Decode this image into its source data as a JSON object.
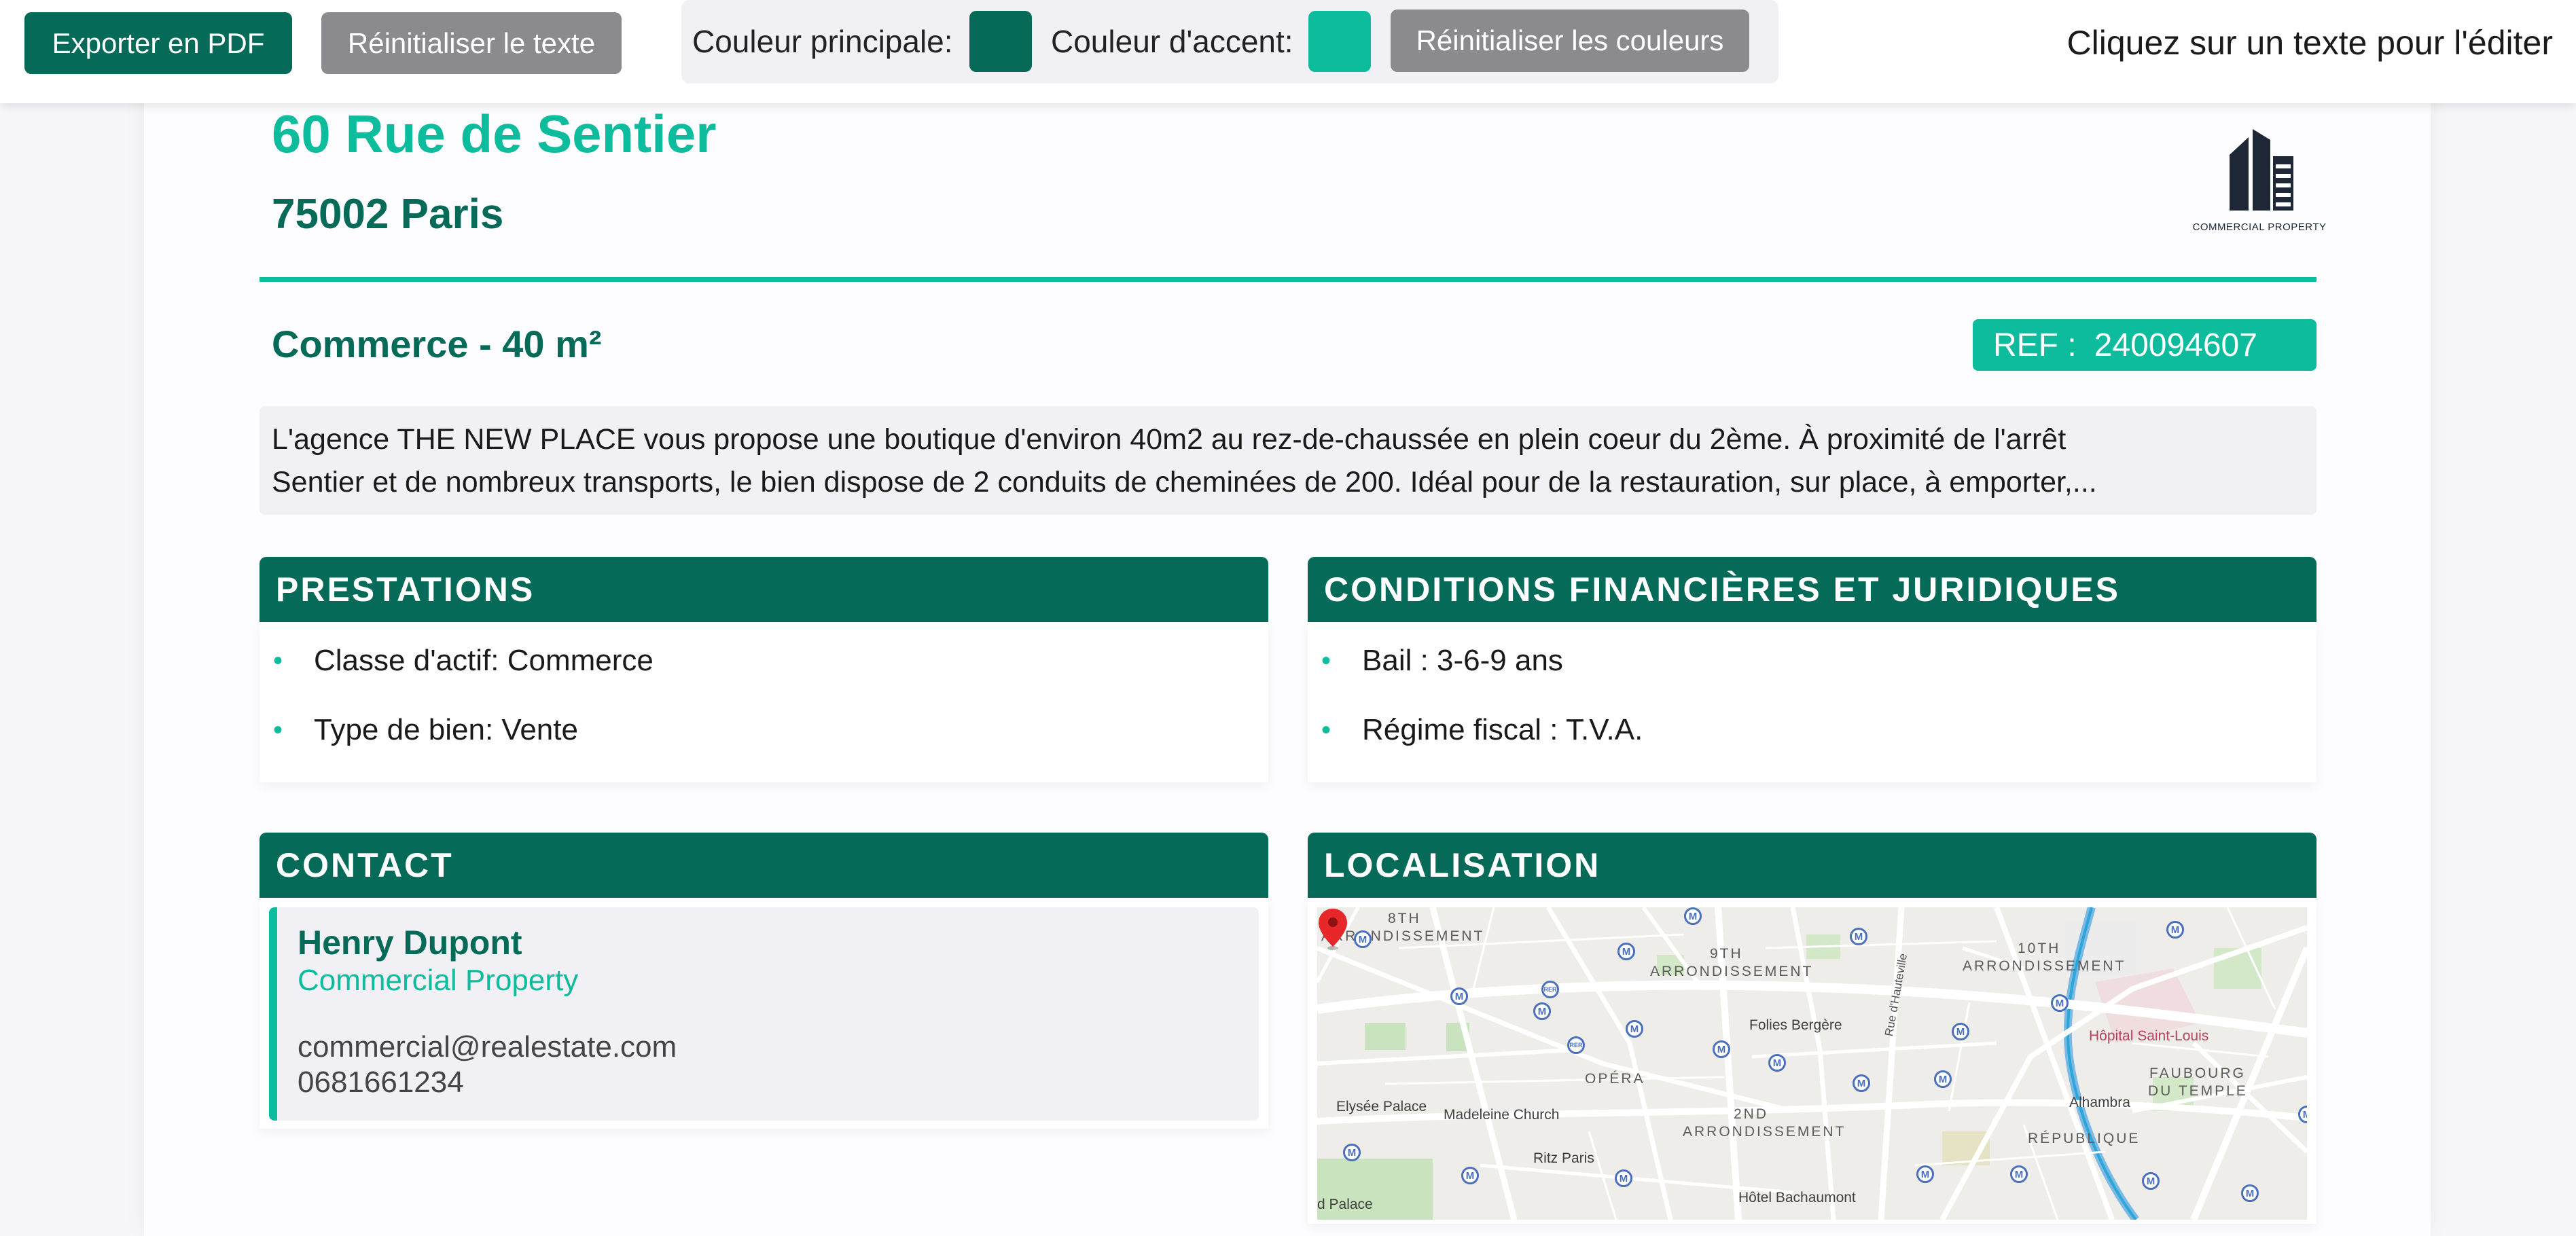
{
  "toolbar": {
    "export_label": "Exporter en PDF",
    "reset_text_label": "Réinitialiser le texte",
    "main_color_label": "Couleur principale:",
    "accent_color_label": "Couleur d'accent:",
    "reset_colors_label": "Réinitialiser les couleurs",
    "hint": "Cliquez sur un texte pour l'éditer"
  },
  "colors": {
    "main": "#056b58",
    "accent": "#0cbc9c"
  },
  "listing": {
    "address_line1": "60 Rue de Sentier",
    "address_line2": "75002 Paris",
    "logo_icon": "building-icon",
    "logo_caption": "COMMERCIAL PROPERTY",
    "subtitle": "Commerce - 40 m²",
    "ref_label": "REF :",
    "ref_value": "240094607",
    "description_line1": "L'agence THE NEW PLACE vous propose une boutique d'environ 40m2 au rez-de-chaussée en plein coeur du 2ème. À proximité de l'arrêt",
    "description_line2": "Sentier et de nombreux transports, le bien dispose de 2 conduits de cheminées de 200. Idéal pour de la restauration, sur place, à emporter,..."
  },
  "prestations": {
    "title": "PRESTATIONS",
    "items": [
      "Classe d'actif: Commerce",
      "Type de bien: Vente"
    ]
  },
  "conditions": {
    "title": "CONDITIONS FINANCIÈRES ET JURIDIQUES",
    "items": [
      "Bail : 3-6-9 ans",
      "Régime fiscal : T.V.A."
    ]
  },
  "contact": {
    "title": "CONTACT",
    "name": "Henry Dupont",
    "company": "Commercial Property",
    "email": "commercial@realestate.com",
    "phone": "0681661234"
  },
  "location": {
    "title": "LOCALISATION",
    "districts": [
      "8TH",
      "ARRONDISSEMENT",
      "9TH",
      "ARRONDISSEMENT",
      "10TH",
      "ARRONDISSEMENT",
      "OPÉRA",
      "2ND",
      "ARRONDISSEMENT",
      "FAUBOURG",
      "DU TEMPLE",
      "RÉPUBLIQUE"
    ],
    "places": [
      "Folies Bergère",
      "Rue d'Hauteville",
      "Hôpital Saint-Louis",
      "Elysée Palace",
      "Madeleine Church",
      "Alhambra",
      "Ritz Paris",
      "Hôtel Bachaumont",
      "d Palace"
    ],
    "metro_symbol": "M",
    "rer_symbol": "RER",
    "marker_icon": "map-pin-icon"
  }
}
